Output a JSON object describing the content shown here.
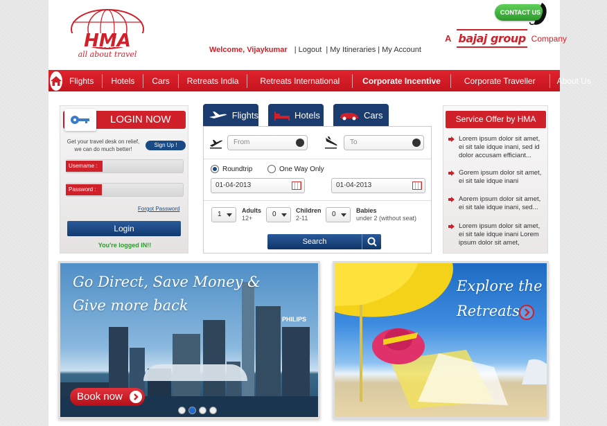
{
  "header": {
    "logo_text": "HMA",
    "logo_tagline": "all about travel",
    "welcome": "Welcome, Vijaykumar",
    "links": [
      "Logout",
      "My Itineraries",
      "My Account"
    ],
    "contact_label": "CONTACT US",
    "company_prefix": "A",
    "company_brand": "bajaj group",
    "company_suffix": "Company"
  },
  "nav": {
    "items": [
      {
        "label": "Flights",
        "bold": false
      },
      {
        "label": "Hotels",
        "bold": false
      },
      {
        "label": "Cars",
        "bold": false
      },
      {
        "label": "Retreats India",
        "bold": false
      },
      {
        "label": "Retreats International",
        "bold": false
      },
      {
        "label": "Corporate Incentive",
        "bold": true
      },
      {
        "label": "Corporate Traveller",
        "bold": false
      },
      {
        "label": "About Us",
        "bold": false
      }
    ]
  },
  "login": {
    "title": "LOGIN NOW",
    "description": "Get your travel desk on relief, we can do much better!",
    "signup_label": "Sign Up !",
    "username_label": "Username :",
    "password_label": "Password :",
    "forgot_label": "Forgot Password",
    "login_label": "Login",
    "status": "You're logged IN!!"
  },
  "search": {
    "tabs": [
      "Flights",
      "Hotels",
      "Cars"
    ],
    "from_placeholder": "From",
    "to_placeholder": "To",
    "trip_options": [
      "Roundtrip",
      "One Way Only"
    ],
    "depart_date": "01-04-2013",
    "return_date": "01-04-2013",
    "adults": {
      "value": "1",
      "label": "Adults",
      "sub": "12+"
    },
    "children": {
      "value": "0",
      "label": "Children",
      "sub": "2-11"
    },
    "babies": {
      "value": "0",
      "label": "Babies",
      "sub": "under 2 (without seat)"
    },
    "search_label": "Search"
  },
  "offers": {
    "title": "Service Offer by HMA",
    "items": [
      "Lorem ipsum dolor sit amet, ei sit tale idque inani, sed id dolor accusam efficiant...",
      "Gorem ipsum dolor sit amet, ei sit tale idque inani",
      "Aorem ipsum dolor sit amet, ei sit tale idque inani, sed...",
      "Lorem ipsum dolor sit amet, ei sit tale idque inani Lorem ipsum dolor sit amet,"
    ]
  },
  "banners": {
    "left_line1": "Go Direct, Save Money &",
    "left_line2": "Give more back",
    "book_label": "Book now",
    "right_line1": "Explore the",
    "right_line2": "Retreats",
    "building_sign": "PHILIPS"
  },
  "colors": {
    "brand_red": "#d0202a",
    "navy": "#1a3c6e",
    "success_green": "#2c9a2a"
  }
}
